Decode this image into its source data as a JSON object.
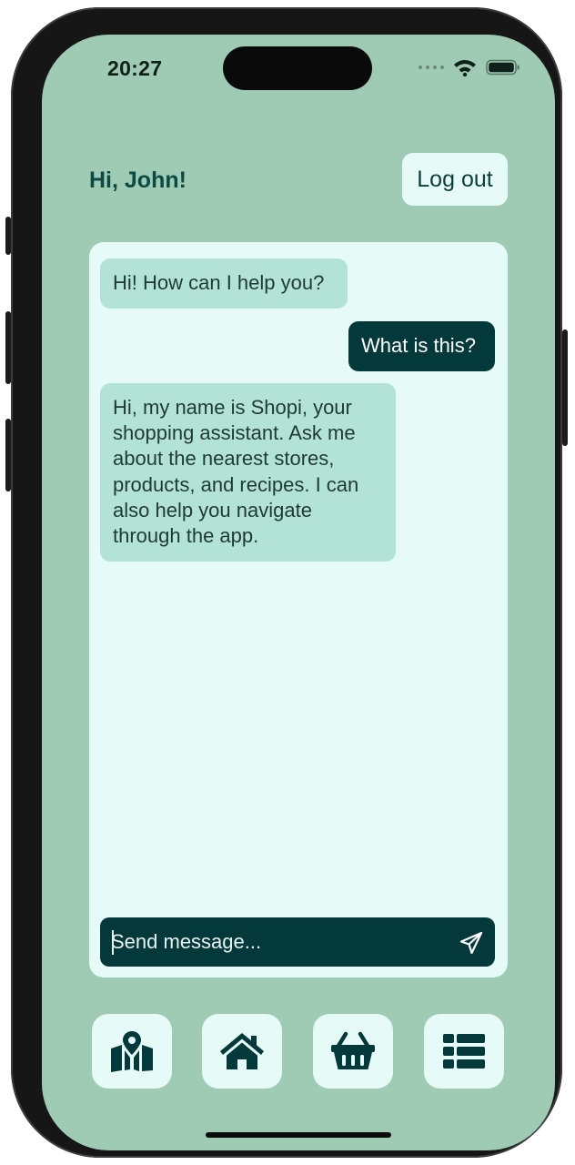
{
  "status_bar": {
    "time": "20:27"
  },
  "header": {
    "greeting": "Hi, John!",
    "logout_label": "Log out"
  },
  "chat": {
    "messages": [
      {
        "sender": "bot",
        "text": "Hi! How can I help you?"
      },
      {
        "sender": "user",
        "text": "What is this?"
      },
      {
        "sender": "bot",
        "text": "Hi, my name is Shopi, your shopping assistant. Ask me about the nearest stores, products, and recipes. I can also help you navigate through the app."
      }
    ],
    "input": {
      "placeholder": "Send message...",
      "value": ""
    },
    "send_icon": "send-icon"
  },
  "nav": {
    "items": [
      {
        "icon": "map-icon"
      },
      {
        "icon": "home-icon"
      },
      {
        "icon": "basket-icon"
      },
      {
        "icon": "list-icon"
      }
    ]
  },
  "colors": {
    "background": "#9fcab3",
    "panel": "#e6fbf8",
    "bot_bubble": "#b2e3d6",
    "user_bubble": "#04393b",
    "accent_text": "#0c4a45"
  }
}
